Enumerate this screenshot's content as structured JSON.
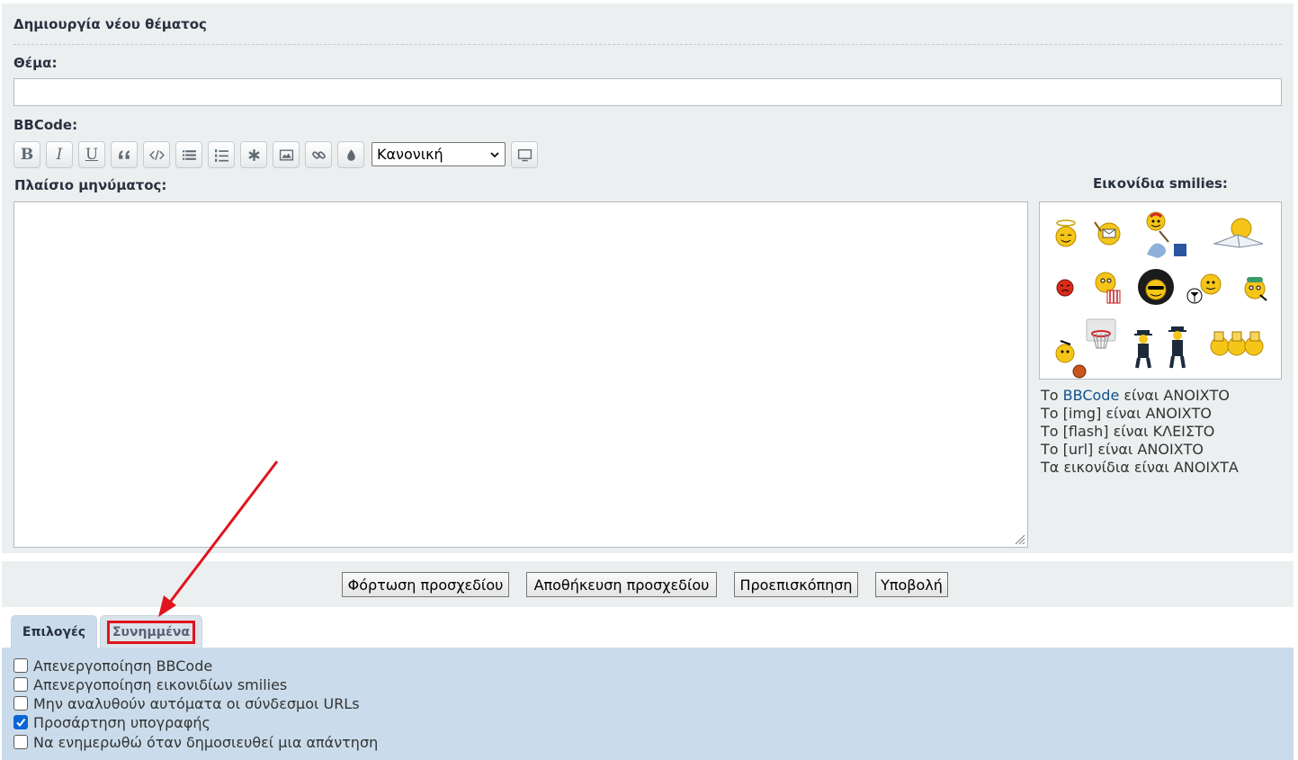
{
  "form": {
    "heading": "Δημιουργία νέου θέματος",
    "subject_label": "Θέμα:",
    "subject_value": "",
    "bbcode_label": "BBCode:",
    "message_label": "Πλαίσιο μηνύματος:",
    "message_value": ""
  },
  "toolbar": {
    "buttons": [
      "bold",
      "italic",
      "underline",
      "quote",
      "code",
      "list",
      "list-numbered",
      "list-item",
      "image",
      "link",
      "color"
    ],
    "bold_glyph": "B",
    "italic_glyph": "I",
    "underline_glyph": "U",
    "font_size_selected": "Κανονική"
  },
  "smilies": {
    "title": "Εικονίδια smilies:"
  },
  "status": {
    "line1_prefix": "Το ",
    "line1_link": "BBCode",
    "line1_suffix": " είναι ΑΝΟΙΧΤΟ",
    "line2": "Το [img] είναι ΑΝΟΙΧΤΟ",
    "line3": "Το [flash] είναι ΚΛΕΙΣΤΟ",
    "line4": "Το [url] είναι ΑΝΟΙΧΤΟ",
    "line5": "Τα εικονίδια είναι ΑΝΟΙΧΤΑ"
  },
  "actions": {
    "load_draft": "Φόρτωση προσχεδίου",
    "save_draft": "Αποθήκευση προσχεδίου",
    "preview": "Προεπισκόπηση",
    "submit": "Υποβολή"
  },
  "tabs": {
    "options": "Επιλογές",
    "attachments": "Συνημμένα"
  },
  "options": {
    "disable_bbcode": "Απενεργοποίηση BBCode",
    "disable_smilies": "Απενεργοποίηση εικονιδίων smilies",
    "no_auto_urls": "Μην αναλυθούν αυτόματα οι σύνδεσμοι URLs",
    "attach_signature": "Προσάρτηση υπογραφής",
    "notify_reply": "Να ενημερωθώ όταν δημοσιευθεί μια απάντηση",
    "attach_signature_checked": true
  },
  "colors": {
    "panel_bg": "#eceff0",
    "options_bg": "#cadceb",
    "highlight_red": "#e0141e",
    "link_blue": "#105289",
    "checkbox_blue": "#0b66d6"
  }
}
